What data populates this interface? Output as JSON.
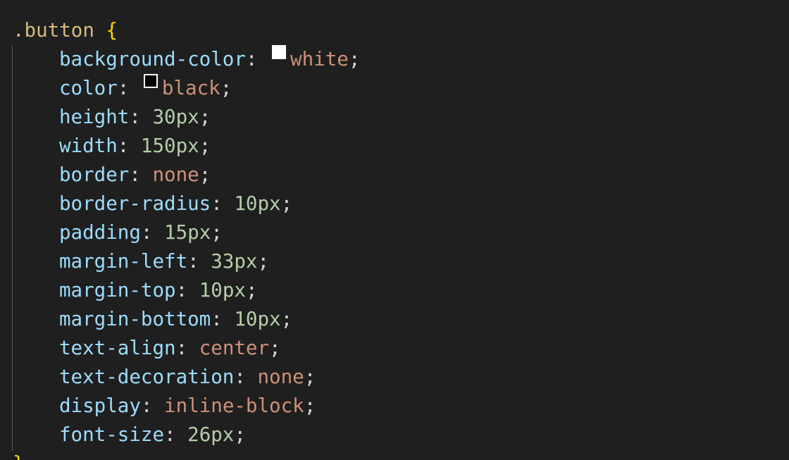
{
  "selector": ".button",
  "open_brace": "{",
  "close_brace": "}",
  "declarations": [
    {
      "property": "background-color",
      "value": "white",
      "value_type": "keyword",
      "swatch": "#ffffff"
    },
    {
      "property": "color",
      "value": "black",
      "value_type": "keyword",
      "swatch": "#000000"
    },
    {
      "property": "height",
      "value": "30px",
      "value_type": "number"
    },
    {
      "property": "width",
      "value": "150px",
      "value_type": "number"
    },
    {
      "property": "border",
      "value": "none",
      "value_type": "keyword"
    },
    {
      "property": "border-radius",
      "value": "10px",
      "value_type": "number"
    },
    {
      "property": "padding",
      "value": "15px",
      "value_type": "number"
    },
    {
      "property": "margin-left",
      "value": "33px",
      "value_type": "number"
    },
    {
      "property": "margin-top",
      "value": "10px",
      "value_type": "number"
    },
    {
      "property": "margin-bottom",
      "value": "10px",
      "value_type": "number"
    },
    {
      "property": "text-align",
      "value": "center",
      "value_type": "keyword"
    },
    {
      "property": "text-decoration",
      "value": "none",
      "value_type": "keyword"
    },
    {
      "property": "display",
      "value": "inline-block",
      "value_type": "keyword"
    },
    {
      "property": "font-size",
      "value": "26px",
      "value_type": "number"
    }
  ],
  "colors": {
    "background": "#1f1f1f",
    "selector": "#d7ba7d",
    "brace": "#ffd700",
    "property": "#9cdcfe",
    "number": "#b5cea8",
    "keyword": "#ce9178",
    "punctuation": "#d4d4d4"
  }
}
